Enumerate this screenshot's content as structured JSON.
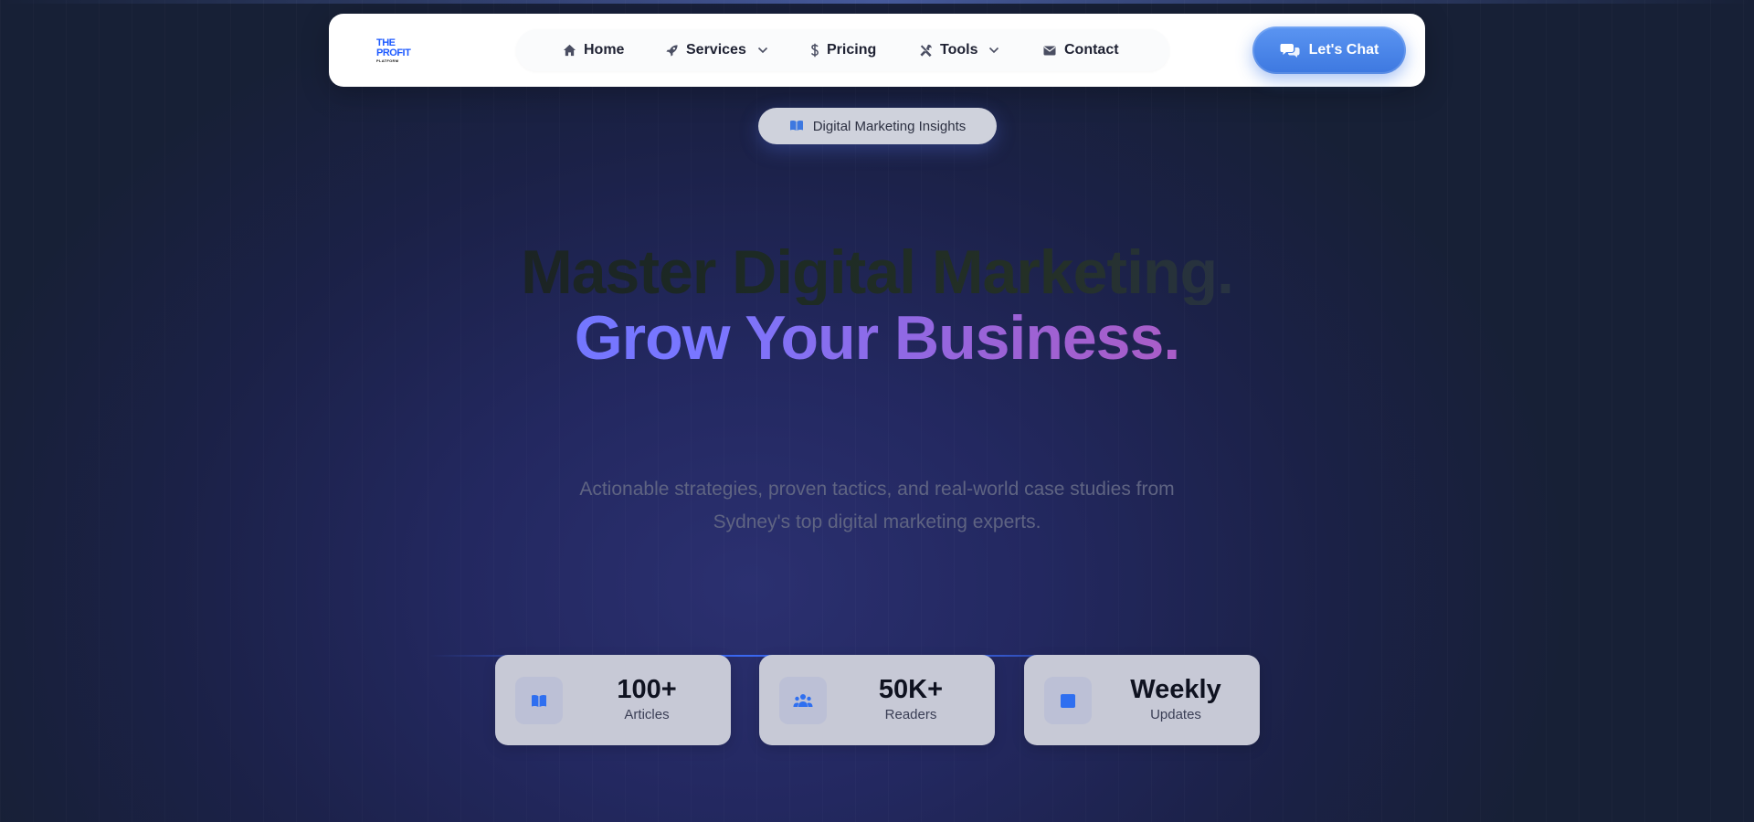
{
  "brand": {
    "logo_line1": "THE",
    "logo_line2": "PROFIT",
    "logo_line3": "PLATFORM",
    "accent_color": "#3d78e0"
  },
  "nav": {
    "items": [
      {
        "label": "Home",
        "icon": "home-icon",
        "has_dropdown": false
      },
      {
        "label": "Services",
        "icon": "rocket-icon",
        "has_dropdown": true
      },
      {
        "label": "Pricing",
        "icon": "dollar-icon",
        "has_dropdown": false
      },
      {
        "label": "Tools",
        "icon": "tools-icon",
        "has_dropdown": true
      },
      {
        "label": "Contact",
        "icon": "envelope-icon",
        "has_dropdown": false
      }
    ],
    "cta_label": "Let's Chat",
    "cta_icon": "chat-icon"
  },
  "hero": {
    "badge_label": "Digital Marketing Insights",
    "badge_icon": "book-open-icon",
    "headline_line1": "Master Digital Marketing.",
    "headline_line2": "Grow Your Business.",
    "subtitle_line1": "Actionable strategies, proven tactics, and real-world case studies from",
    "subtitle_line2": "Sydney's top digital marketing experts."
  },
  "stats": [
    {
      "value": "100+",
      "label": "Articles",
      "icon": "book-icon"
    },
    {
      "value": "50K+",
      "label": "Readers",
      "icon": "users-icon"
    },
    {
      "value": "Weekly",
      "label": "Updates",
      "icon": "calendar-icon"
    }
  ]
}
